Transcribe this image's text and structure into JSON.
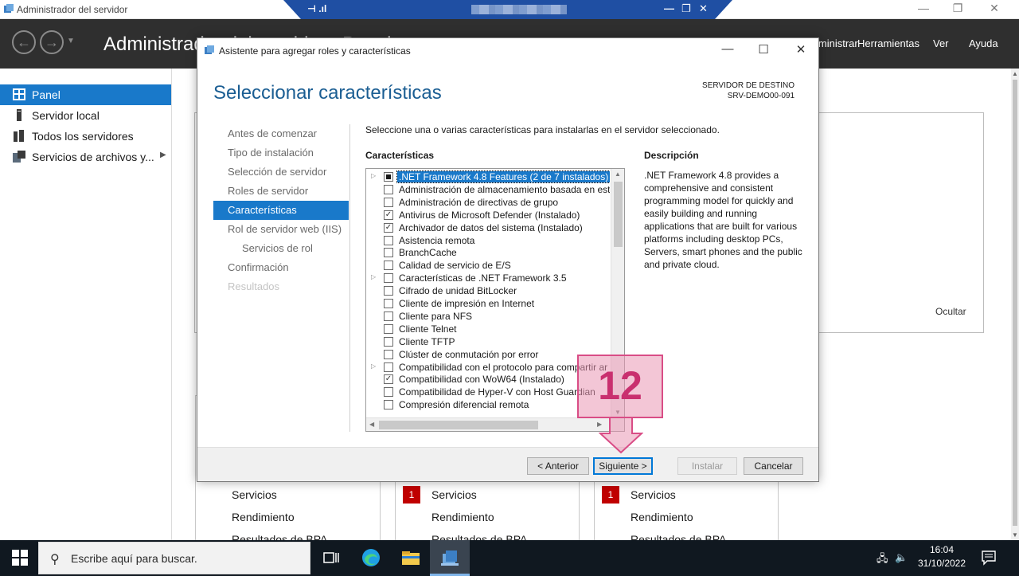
{
  "window": {
    "title": "Administrador del servidor",
    "header_title": "Administrador del servidor · Panel",
    "menu": [
      "Administrar",
      "Herramientas",
      "Ver",
      "Ayuda"
    ]
  },
  "rdp": {
    "left_label": "⊣ .ıl",
    "host_blurred": true
  },
  "sidebar": {
    "items": [
      {
        "label": "Panel",
        "active": true,
        "icon": "dashboard-icon"
      },
      {
        "label": "Servidor local",
        "active": false,
        "icon": "server-icon"
      },
      {
        "label": "Todos los servidores",
        "active": false,
        "icon": "servers-icon"
      },
      {
        "label": "Servicios de archivos y...",
        "active": false,
        "icon": "file-services-icon"
      }
    ]
  },
  "content": {
    "hide_link": "Ocultar",
    "tiles": [
      {
        "badge": "",
        "rows": [
          "Servicios",
          "Rendimiento",
          "Resultados de BPA"
        ]
      },
      {
        "badge": "1",
        "rows": [
          "Servicios",
          "Rendimiento",
          "Resultados de BPA"
        ]
      },
      {
        "badge": "1",
        "rows": [
          "Servicios",
          "Rendimiento",
          "Resultados de BPA"
        ]
      }
    ]
  },
  "wizard": {
    "title": "Asistente para agregar roles y características",
    "heading": "Seleccionar características",
    "dest_label": "SERVIDOR DE DESTINO",
    "dest_host": "SRV-DEMO00-091",
    "steps": [
      {
        "label": "Antes de comenzar",
        "state": "normal",
        "sub": false
      },
      {
        "label": "Tipo de instalación",
        "state": "normal",
        "sub": false
      },
      {
        "label": "Selección de servidor",
        "state": "normal",
        "sub": false
      },
      {
        "label": "Roles de servidor",
        "state": "normal",
        "sub": false
      },
      {
        "label": "Características",
        "state": "active",
        "sub": false
      },
      {
        "label": "Rol de servidor web (IIS)",
        "state": "normal",
        "sub": false
      },
      {
        "label": "Servicios de rol",
        "state": "normal",
        "sub": true
      },
      {
        "label": "Confirmación",
        "state": "normal",
        "sub": false
      },
      {
        "label": "Resultados",
        "state": "disabled",
        "sub": false
      }
    ],
    "instruction": "Seleccione una o varias características para instalarlas en el servidor seleccionado.",
    "features_heading": "Características",
    "description_heading": "Descripción",
    "description_text": ".NET Framework 4.8 provides a comprehensive and consistent programming model for quickly and easily building and running applications that are built for various platforms including desktop PCs, Servers, smart phones and the public and private cloud.",
    "features": [
      {
        "label": ".NET Framework 4.8 Features (2 de 7 instalados)",
        "state": "partial",
        "expandable": true,
        "selected": true
      },
      {
        "label": "Administración de almacenamiento basada en está",
        "state": "unchecked",
        "expandable": false,
        "selected": false
      },
      {
        "label": "Administración de directivas de grupo",
        "state": "unchecked",
        "expandable": false,
        "selected": false
      },
      {
        "label": "Antivirus de Microsoft Defender (Instalado)",
        "state": "checked",
        "expandable": false,
        "selected": false
      },
      {
        "label": "Archivador de datos del sistema (Instalado)",
        "state": "checked",
        "expandable": false,
        "selected": false
      },
      {
        "label": "Asistencia remota",
        "state": "unchecked",
        "expandable": false,
        "selected": false
      },
      {
        "label": "BranchCache",
        "state": "unchecked",
        "expandable": false,
        "selected": false
      },
      {
        "label": "Calidad de servicio de E/S",
        "state": "unchecked",
        "expandable": false,
        "selected": false
      },
      {
        "label": "Características de .NET Framework 3.5",
        "state": "unchecked",
        "expandable": true,
        "selected": false
      },
      {
        "label": "Cifrado de unidad BitLocker",
        "state": "unchecked",
        "expandable": false,
        "selected": false
      },
      {
        "label": "Cliente de impresión en Internet",
        "state": "unchecked",
        "expandable": false,
        "selected": false
      },
      {
        "label": "Cliente para NFS",
        "state": "unchecked",
        "expandable": false,
        "selected": false
      },
      {
        "label": "Cliente Telnet",
        "state": "unchecked",
        "expandable": false,
        "selected": false
      },
      {
        "label": "Cliente TFTP",
        "state": "unchecked",
        "expandable": false,
        "selected": false
      },
      {
        "label": "Clúster de conmutación por error",
        "state": "unchecked",
        "expandable": false,
        "selected": false
      },
      {
        "label": "Compatibilidad con el protocolo para compartir ar",
        "state": "unchecked",
        "expandable": true,
        "selected": false
      },
      {
        "label": "Compatibilidad con WoW64 (Instalado)",
        "state": "checked",
        "expandable": false,
        "selected": false
      },
      {
        "label": "Compatibilidad de Hyper-V con Host Guardian",
        "state": "unchecked",
        "expandable": false,
        "selected": false
      },
      {
        "label": "Compresión diferencial remota",
        "state": "unchecked",
        "expandable": false,
        "selected": false
      }
    ],
    "buttons": {
      "previous": "< Anterior",
      "next": "Siguiente >",
      "install": "Instalar",
      "cancel": "Cancelar"
    }
  },
  "annotation": {
    "step_number": "12",
    "color": "#d94d86"
  },
  "taskbar": {
    "search_placeholder": "Escribe aquí para buscar.",
    "time": "16:04",
    "date": "31/10/2022"
  }
}
